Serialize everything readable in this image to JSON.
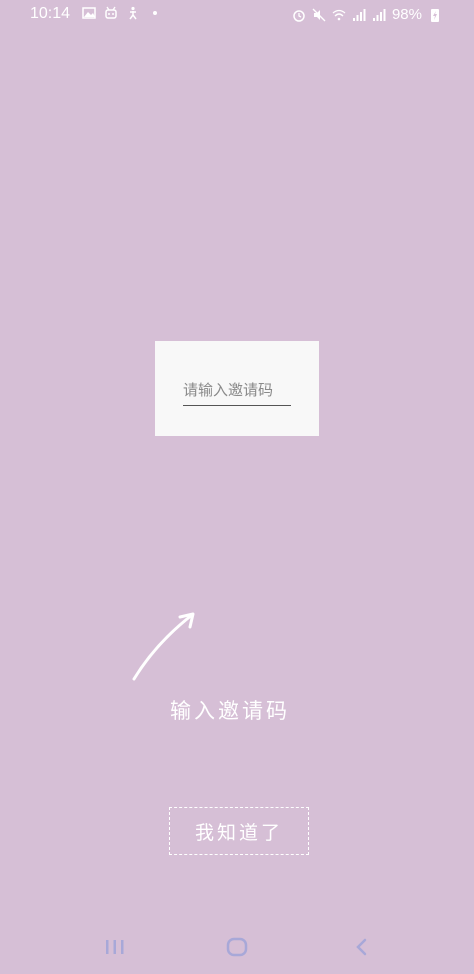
{
  "status_bar": {
    "time": "10:14",
    "battery": "98%",
    "left_icons": [
      "image-icon",
      "android-bot-icon",
      "accessibility-icon",
      "dot-icon"
    ],
    "right_icons": [
      "alarm-icon",
      "mute-icon",
      "wifi-icon",
      "signal-icon",
      "signal-icon",
      "charging-icon"
    ]
  },
  "invite": {
    "placeholder": "请输入邀请码"
  },
  "guide": {
    "hint": "输入邀请码",
    "got_it_label": "我知道了"
  },
  "nav": {
    "icons": [
      "recent-apps-icon",
      "home-icon",
      "back-icon"
    ]
  },
  "colors": {
    "background": "#d6bfd6",
    "card": "#f8f8f8",
    "text_light": "#ffffff",
    "placeholder": "#8a8a8a"
  }
}
